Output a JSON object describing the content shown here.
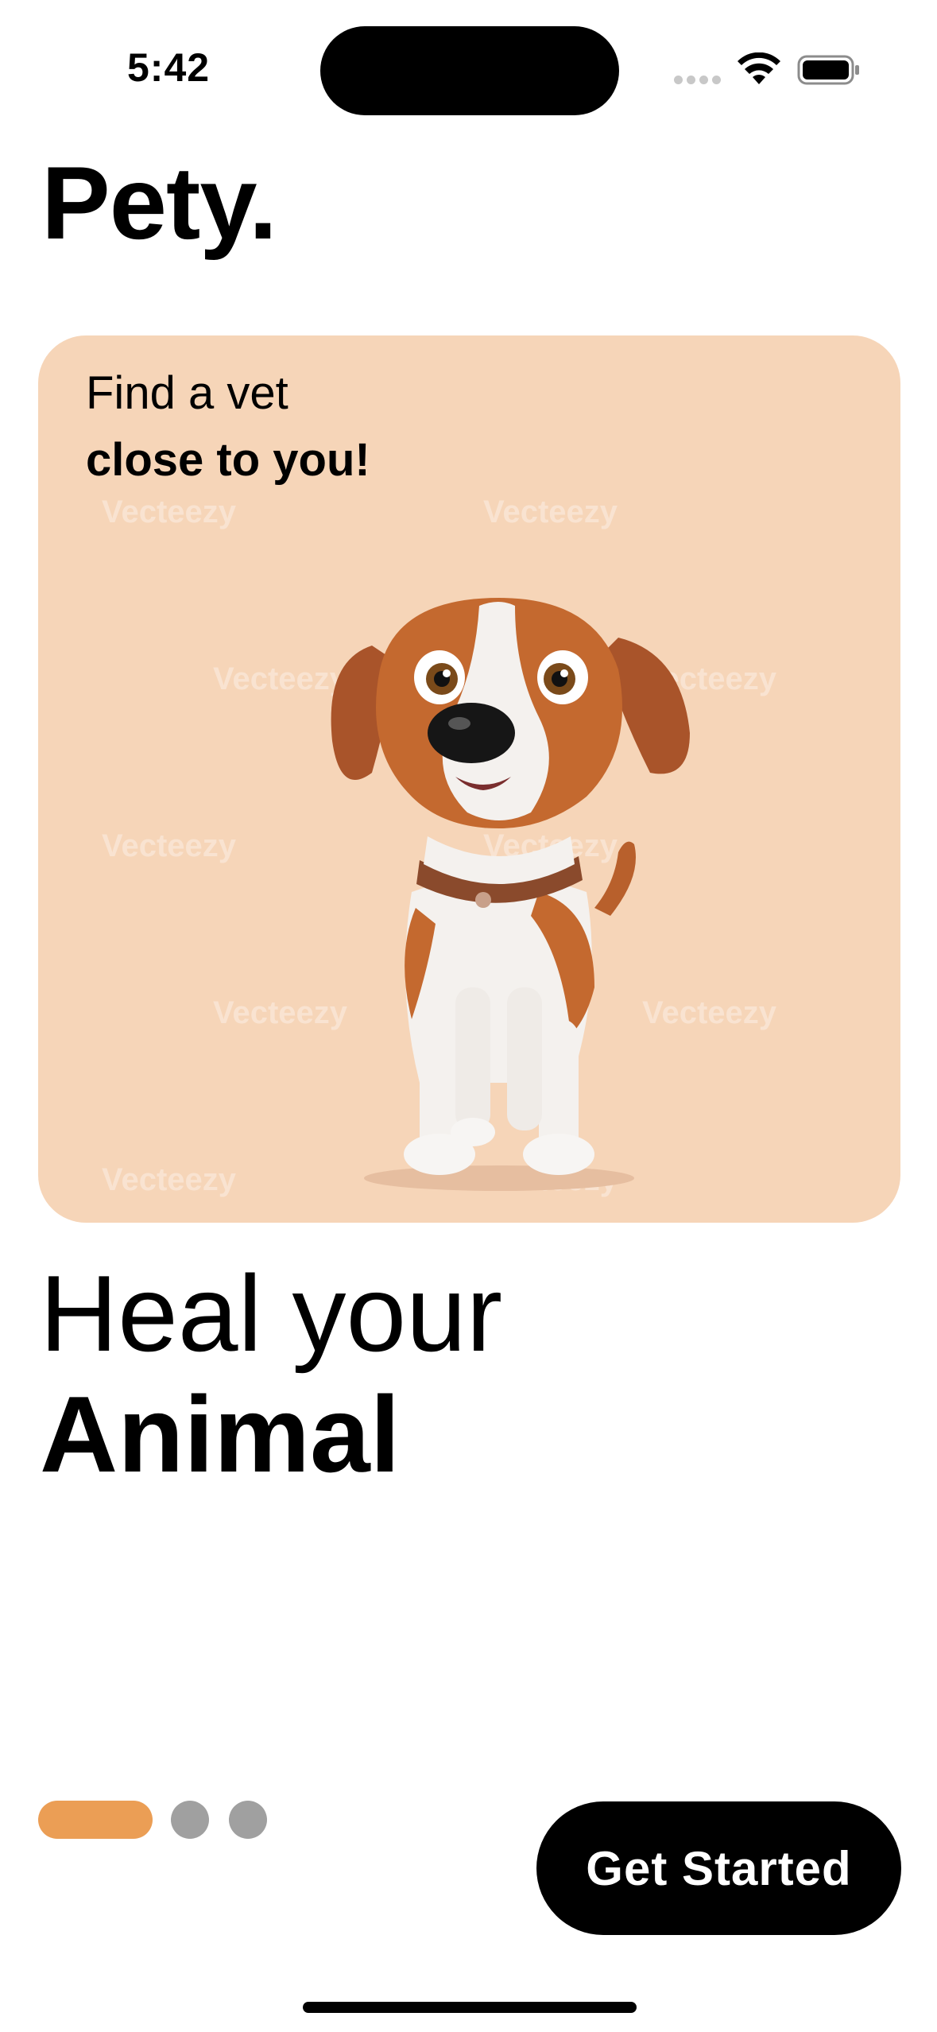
{
  "status_bar": {
    "time": "5:42"
  },
  "brand": {
    "name": "Pety."
  },
  "hero": {
    "line1": "Find a vet",
    "line2": "close to you!",
    "watermark": "Vecteezy",
    "illustration": "cartoon-beagle-dog"
  },
  "headline": {
    "line1": "Heal your",
    "line2": "Animal"
  },
  "pager": {
    "current": 1,
    "total": 3
  },
  "cta": {
    "label": "Get Started"
  },
  "colors": {
    "card_background": "#f6d5b8",
    "accent": "#eb9e55",
    "inactive_dot": "#a0a0a0",
    "button_background": "#000000",
    "button_text": "#ffffff"
  }
}
